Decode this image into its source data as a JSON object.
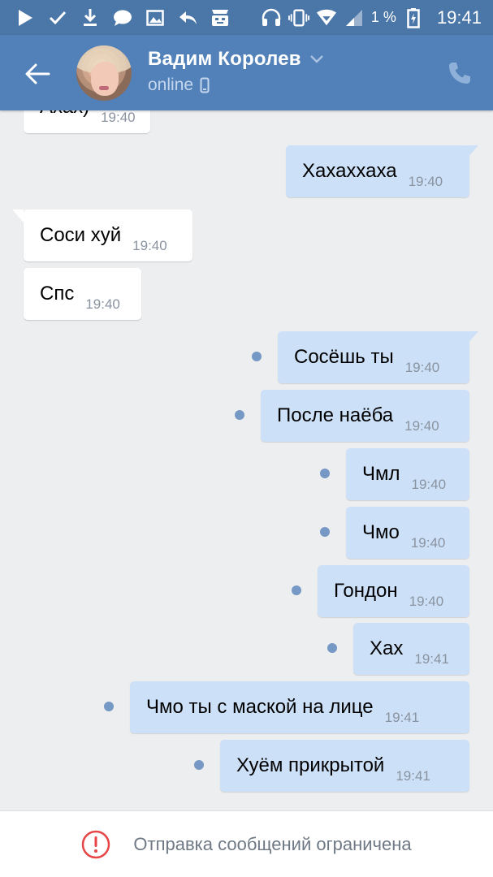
{
  "status_bar": {
    "battery_percent": "1 %",
    "time": "19:41",
    "icons_left": [
      "play-icon",
      "check-icon",
      "download-icon",
      "chat-bubble-icon",
      "image-icon",
      "reply-icon",
      "robot-icon"
    ],
    "icons_right": [
      "headset-icon",
      "vibrate-icon",
      "wifi-icon",
      "signal-icon",
      "battery-icon"
    ]
  },
  "header": {
    "contact_name": "Вадим Королев",
    "status": "online",
    "accent_color": "#5181b8"
  },
  "messages": [
    {
      "direction": "in",
      "text": "Ахах)",
      "time": "19:40"
    },
    {
      "direction": "out",
      "text": "Хахаххаха",
      "time": "19:40",
      "unread": false
    },
    {
      "direction": "in",
      "text": "Соси хуй",
      "time": "19:40"
    },
    {
      "direction": "in",
      "text": "Спс",
      "time": "19:40"
    },
    {
      "direction": "out",
      "text": "Сосёшь ты",
      "time": "19:40",
      "unread": true
    },
    {
      "direction": "out",
      "text": "После наёба",
      "time": "19:40",
      "unread": true
    },
    {
      "direction": "out",
      "text": "Чмл",
      "time": "19:40",
      "unread": true
    },
    {
      "direction": "out",
      "text": "Чмо",
      "time": "19:40",
      "unread": true
    },
    {
      "direction": "out",
      "text": "Гондон",
      "time": "19:40",
      "unread": true
    },
    {
      "direction": "out",
      "text": "Хах",
      "time": "19:41",
      "unread": true
    },
    {
      "direction": "out",
      "text": "Чмо ты с маской на лице",
      "time": "19:41",
      "unread": true
    },
    {
      "direction": "out",
      "text": "Хуём прикрытой",
      "time": "19:41",
      "unread": true
    }
  ],
  "bottom_bar": {
    "notice": "Отправка сообщений ограничена",
    "notice_icon": "error-icon"
  }
}
